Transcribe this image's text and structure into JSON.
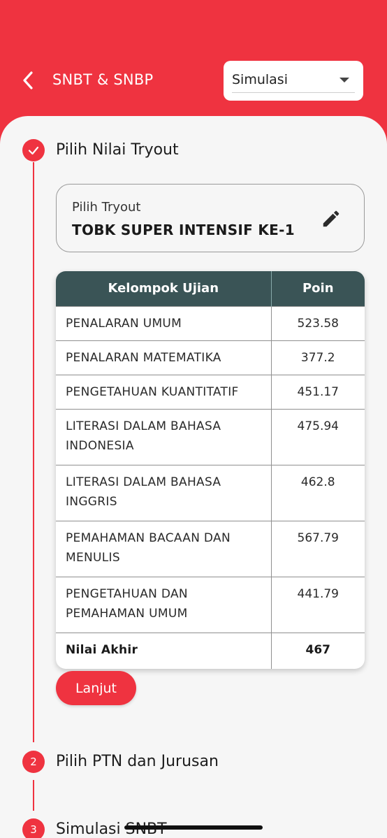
{
  "header": {
    "title": "SNBT & SNBP",
    "mode_select": {
      "value": "Simulasi"
    }
  },
  "steps": [
    {
      "number": "",
      "label": "Pilih Nilai Tryout",
      "state": "completed"
    },
    {
      "number": "2",
      "label": "Pilih PTN dan Jurusan",
      "state": "pending"
    },
    {
      "number": "3",
      "label": "Simulasi SNBT",
      "state": "pending"
    }
  ],
  "tryout": {
    "label": "Pilih Tryout",
    "value": "TOBK SUPER INTENSIF KE-1"
  },
  "table": {
    "columns": [
      "Kelompok Ujian",
      "Poin"
    ],
    "rows": [
      {
        "name": "PENALARAN UMUM",
        "points": "523.58"
      },
      {
        "name": "PENALARAN MATEMATIKA",
        "points": "377.2"
      },
      {
        "name": "PENGETAHUAN KUANTITATIF",
        "points": "451.17"
      },
      {
        "name": "LITERASI DALAM BAHASA INDONESIA",
        "points": "475.94"
      },
      {
        "name": "LITERASI DALAM BAHASA INGGRIS",
        "points": "462.8"
      },
      {
        "name": "PEMAHAMAN BACAAN DAN MENULIS",
        "points": "567.79"
      },
      {
        "name": "PENGETAHUAN DAN PEMAHAMAN UMUM",
        "points": "441.79"
      }
    ],
    "final": {
      "name": "Nilai Akhir",
      "points": "467"
    }
  },
  "next_button": {
    "label": "Lanjut"
  },
  "colors": {
    "accent": "#ef3340",
    "table_header": "#3a5456",
    "sheet_background": "#f6f6f6"
  },
  "icons": {
    "back": "chevron-left-icon",
    "dropdown": "caret-down-icon",
    "edit": "pencil-icon",
    "completed": "check-icon"
  }
}
